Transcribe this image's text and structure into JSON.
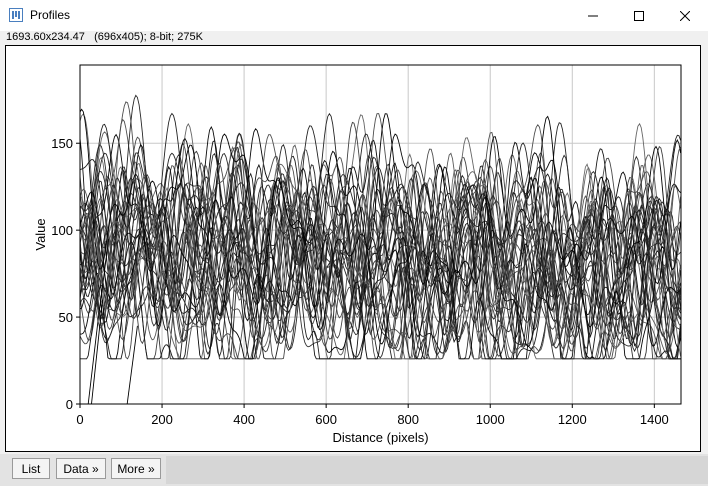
{
  "window": {
    "title": "Profiles",
    "info_line": "1693.60x234.47   (696x405); 8-bit; 275K",
    "controls": [
      "minimize",
      "maximize",
      "close"
    ]
  },
  "buttons": {
    "list": "List",
    "data": "Data »",
    "more": "More »"
  },
  "chart_data": {
    "type": "line",
    "xlabel": "Distance (pixels)",
    "ylabel": "Value",
    "xlim": [
      0,
      1465
    ],
    "ylim": [
      0,
      195
    ],
    "x_ticks": [
      0,
      200,
      400,
      600,
      800,
      1000,
      1200,
      1400
    ],
    "y_ticks": [
      0,
      50,
      100,
      150
    ],
    "grid": true,
    "series_count": 38,
    "line_color": "#000000",
    "note_series": "many overlapping intensity profiles, values mostly between 30 and 195"
  }
}
